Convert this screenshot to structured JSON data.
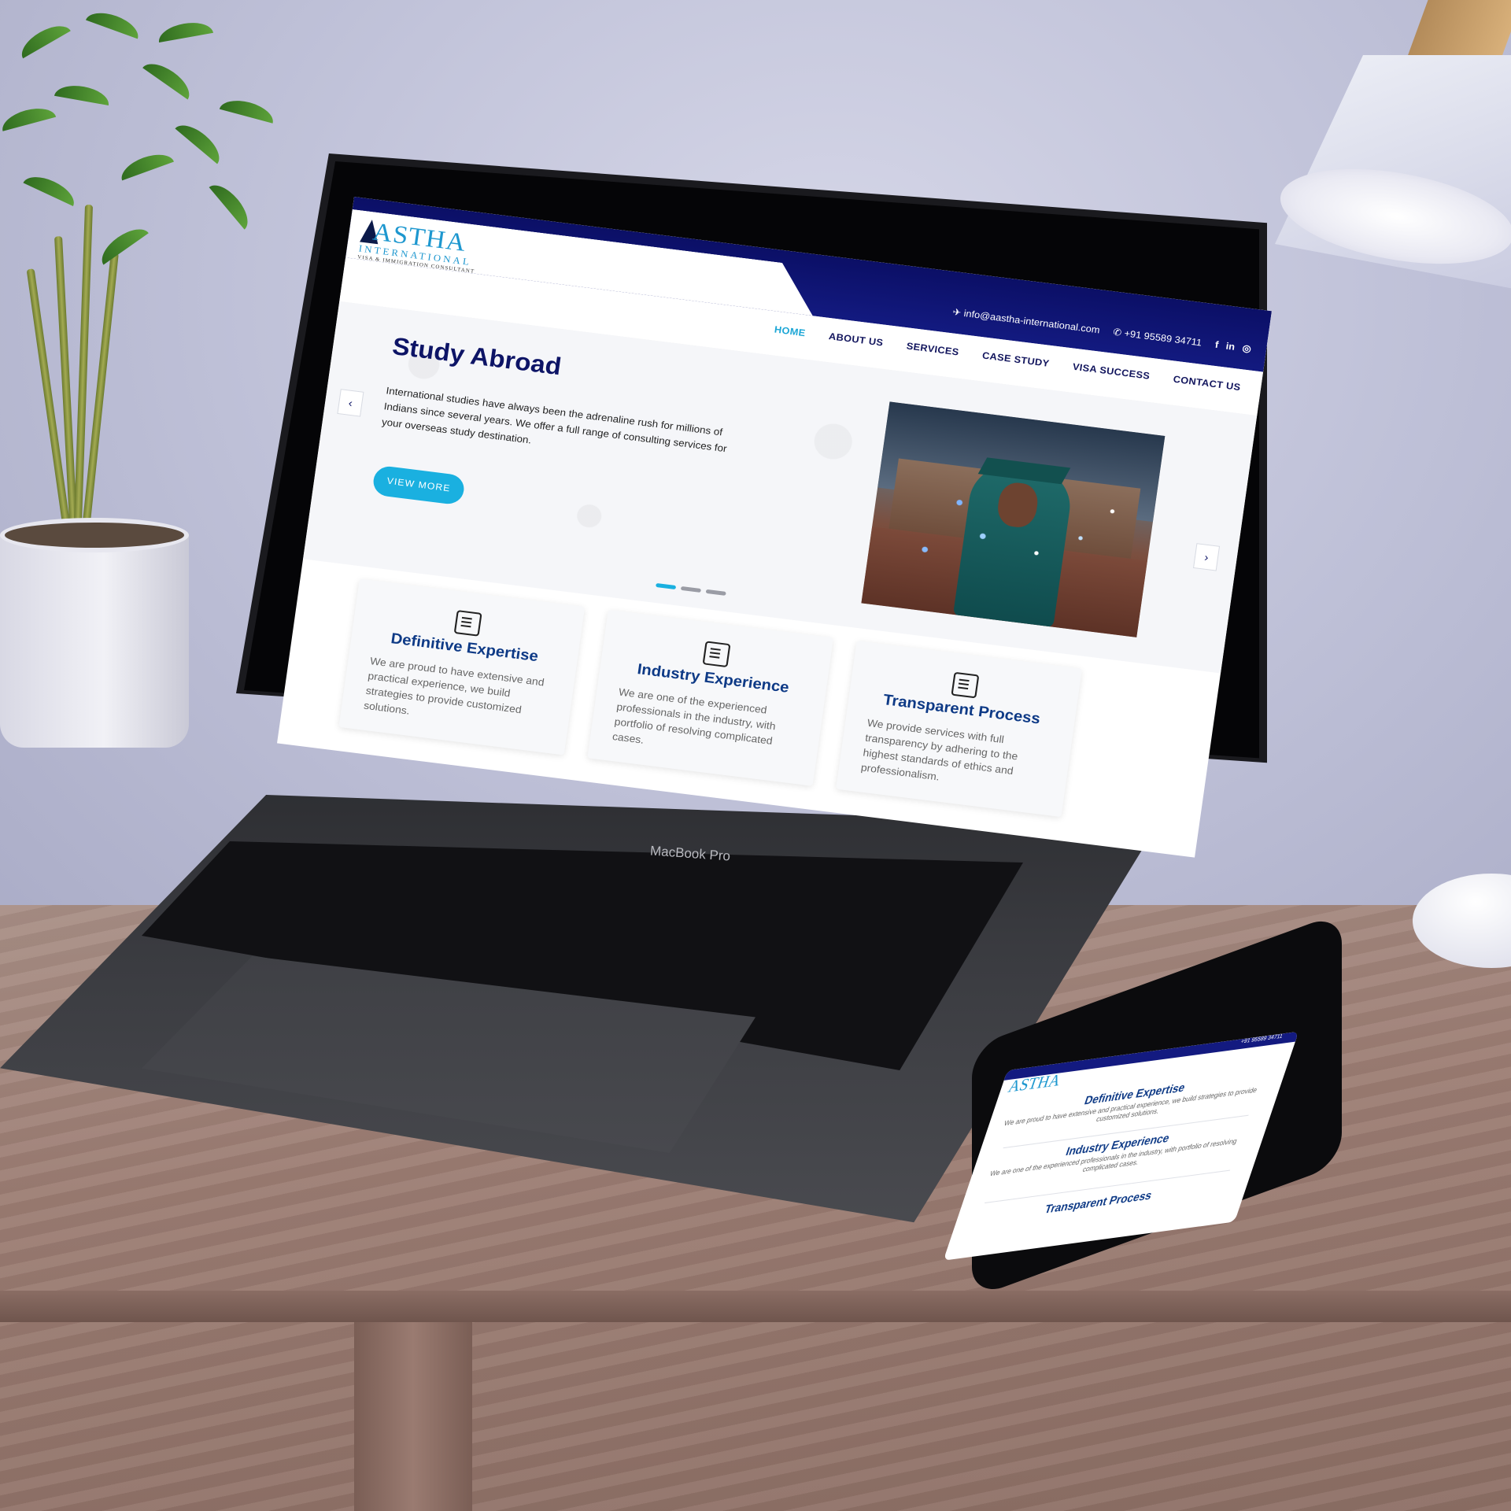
{
  "site": {
    "logo": {
      "name": "ASTHA",
      "subtitle": "INTERNATIONAL",
      "tagline": "VISA & IMMIGRATION CONSULTANT"
    },
    "topbar": {
      "email": "info@aastha-international.com",
      "phone": "+91 95589 34711",
      "social": [
        "f",
        "in",
        "ig"
      ]
    },
    "nav": [
      {
        "label": "HOME",
        "active": true
      },
      {
        "label": "ABOUT US",
        "active": false
      },
      {
        "label": "SERVICES",
        "active": false
      },
      {
        "label": "CASE STUDY",
        "active": false
      },
      {
        "label": "VISA SUCCESS",
        "active": false
      },
      {
        "label": "CONTACT US",
        "active": false
      }
    ],
    "hero": {
      "title": "Study Abroad",
      "text": "International studies have always been the adrenaline rush for millions of Indians since several years. We offer a full range of consulting services for your overseas study destination.",
      "button": "VIEW MORE",
      "prev_icon": "‹",
      "next_icon": "›",
      "slide_count": 3,
      "active_slide": 1
    },
    "features": [
      {
        "title": "Definitive Expertise",
        "text": "We are proud to have extensive and practical experience, we build strategies to provide customized solutions.",
        "icon": "presentation-icon"
      },
      {
        "title": "Industry Experience",
        "text": "We are one of the experienced professionals in the industry, with portfolio of resolving complicated cases.",
        "icon": "certificate-icon"
      },
      {
        "title": "Transparent Process",
        "text": "We provide services with full transparency by adhering to the highest standards of ethics and professionalism.",
        "icon": "chat-icon"
      }
    ],
    "colors": {
      "navy": "#0d1466",
      "accent": "#1ab0e0",
      "card_title": "#0e3a86"
    }
  },
  "device": {
    "laptop_label": "MacBook Pro"
  },
  "phone": {
    "phone_number": "+91 95589 34711",
    "logo": "ASTHA",
    "cards": [
      {
        "title": "Definitive Expertise",
        "text": "We are proud to have extensive and practical experience, we build strategies to provide customized solutions."
      },
      {
        "title": "Industry Experience",
        "text": "We are one of the experienced professionals in the industry, with portfolio of resolving complicated cases."
      },
      {
        "title": "Transparent Process",
        "text": ""
      }
    ]
  }
}
